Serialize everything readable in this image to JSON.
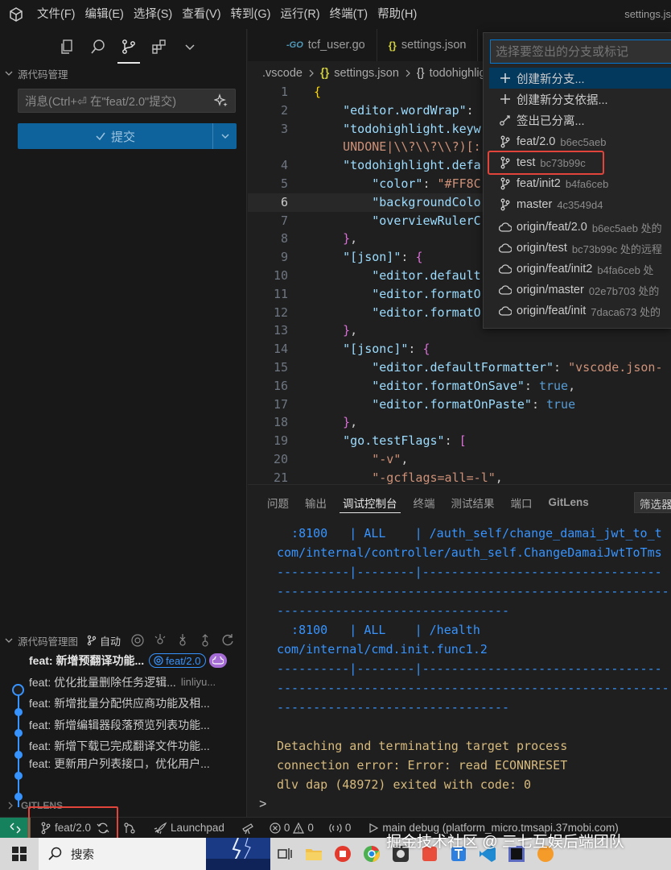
{
  "titlebar": {
    "menu": [
      "文件(F)",
      "编辑(E)",
      "选择(S)",
      "查看(V)",
      "转到(G)",
      "运行(R)",
      "终端(T)",
      "帮助(H)"
    ],
    "window_title": "settings.js"
  },
  "sidebar": {
    "scm_title": "源代码管理",
    "commit_placeholder": "消息(Ctrl+⏎ 在\"feat/2.0\"提交)",
    "commit_label": "提交",
    "graph": {
      "title": "源代码管理图",
      "auto_label": "自动",
      "head_branch": "feat/2.0",
      "commits": [
        {
          "msg": "feat: 新增预翻译功能...",
          "meta": ""
        },
        {
          "msg": "feat: 优化批量删除任务逻辑...",
          "meta": "linliyu..."
        },
        {
          "msg": "feat: 新增批量分配供应商功能及相...",
          "meta": ""
        },
        {
          "msg": "feat: 新增编辑器段落预览列表功能...",
          "meta": ""
        },
        {
          "msg": "feat: 新增下载已完成翻译文件功能...",
          "meta": ""
        },
        {
          "msg": "feat: 更新用户列表接口，优化用户...",
          "meta": ""
        }
      ]
    },
    "gitlens_title": "GITLENS"
  },
  "editor": {
    "tabs": [
      {
        "icon": "-GO",
        "label": "tcf_user.go"
      },
      {
        "icon": "{}",
        "label": "settings.json"
      }
    ],
    "breadcrumbs": [
      ".vscode",
      "settings.json",
      "todohighlight"
    ],
    "lines": [
      {
        "n": "1"
      },
      {
        "n": "2"
      },
      {
        "n": "3"
      },
      {
        "n": ""
      },
      {
        "n": "4"
      },
      {
        "n": "5"
      },
      {
        "n": "6"
      },
      {
        "n": "7"
      },
      {
        "n": "8"
      },
      {
        "n": "9"
      },
      {
        "n": "10"
      },
      {
        "n": "11"
      },
      {
        "n": "12"
      },
      {
        "n": "13"
      },
      {
        "n": "14"
      },
      {
        "n": "15"
      },
      {
        "n": "16"
      },
      {
        "n": "17"
      },
      {
        "n": "18"
      },
      {
        "n": "19"
      },
      {
        "n": "20"
      },
      {
        "n": "21"
      }
    ]
  },
  "quickpick": {
    "placeholder": "选择要签出的分支或标记",
    "items": [
      {
        "icon": "plus-icon",
        "label": "创建新分支...",
        "desc": ""
      },
      {
        "icon": "plus-icon",
        "label": "创建新分支依据...",
        "desc": ""
      },
      {
        "icon": "detach-icon",
        "label": "签出已分离...",
        "desc": ""
      },
      {
        "icon": "branch-icon",
        "label": "feat/2.0",
        "desc": "b6ec5aeb"
      },
      {
        "icon": "branch-icon",
        "label": "test",
        "desc": "bc73b99c"
      },
      {
        "icon": "branch-icon",
        "label": "feat/init2",
        "desc": "b4fa6ceb"
      },
      {
        "icon": "branch-icon",
        "label": "master",
        "desc": "4c3549d4"
      },
      {
        "icon": "cloud-icon",
        "label": "origin/feat/2.0",
        "desc": "b6ec5aeb 处的"
      },
      {
        "icon": "cloud-icon",
        "label": "origin/test",
        "desc": "bc73b99c 处的远程"
      },
      {
        "icon": "cloud-icon",
        "label": "origin/feat/init2",
        "desc": "b4fa6ceb 处"
      },
      {
        "icon": "cloud-icon",
        "label": "origin/master",
        "desc": "02e7b703 处的"
      },
      {
        "icon": "cloud-icon",
        "label": "origin/feat/init",
        "desc": "7daca673 处的"
      }
    ]
  },
  "panel": {
    "tabs": [
      "问题",
      "输出",
      "调试控制台",
      "终端",
      "测试结果",
      "端口",
      "GitLens"
    ],
    "active_tab": "调试控制台",
    "filter_placeholder": "筛选器",
    "console_lines": [
      {
        "text": "  :8100   | ALL    | /auth_self/change_damai_jwt_to_t",
        "color": "blue"
      },
      {
        "text": "com/internal/controller/auth_self.ChangeDamaiJwtToTms",
        "color": "blue"
      },
      {
        "text": "----------|--------|---------------------------------",
        "color": "blue"
      },
      {
        "text": "-------------------------------------------------------",
        "color": "blue"
      },
      {
        "text": "--------------------------------",
        "color": "blue"
      },
      {
        "text": "  :8100   | ALL    | /health",
        "color": "blue"
      },
      {
        "text": "com/internal/cmd.init.func1.2",
        "color": "blue"
      },
      {
        "text": "----------|--------|---------------------------------",
        "color": "blue"
      },
      {
        "text": "-------------------------------------------------------",
        "color": "blue"
      },
      {
        "text": "--------------------------------",
        "color": "blue"
      },
      {
        "text": "",
        "color": "blue"
      },
      {
        "text": "Detaching and terminating target process",
        "color": "orange"
      },
      {
        "text": "connection error: Error: read ECONNRESET",
        "color": "orange"
      },
      {
        "text": "dlv dap (48972) exited with code: 0",
        "color": "orange"
      }
    ],
    "prompt": ">"
  },
  "statusbar": {
    "branch": "feat/2.0",
    "launchpad": "Launchpad",
    "errors": "0",
    "warnings": "0",
    "ports": "0",
    "debug": "main debug (platform_micro.tmsapi.37mobi.com)"
  },
  "taskbar": {
    "search_label": "搜索"
  },
  "watermark": "掘金技术社区 @ 三七互娱后端团队",
  "colors": {
    "accent": "#0078d4",
    "highlight_box": "#e0443a",
    "commit_button": "#0e639c",
    "graph_blue": "#3794ff"
  }
}
